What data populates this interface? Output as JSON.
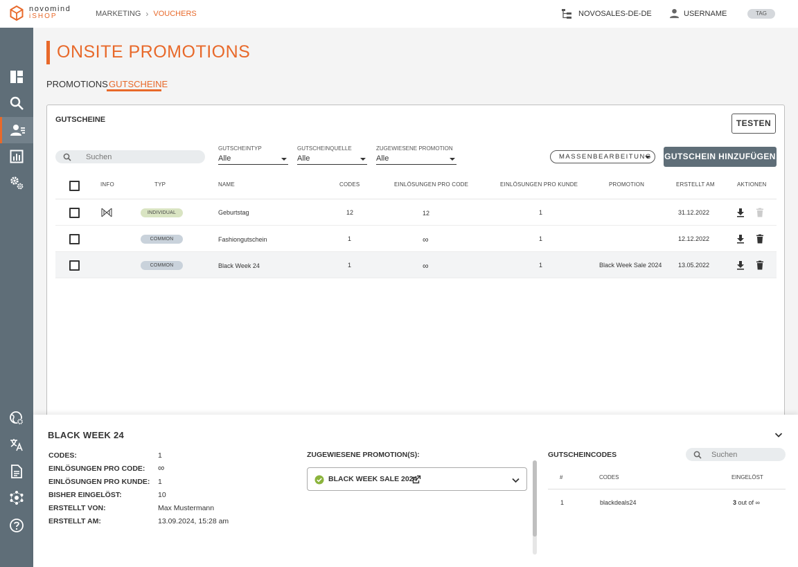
{
  "header": {
    "logo_line1": "novomind",
    "logo_line2": "iSHOP",
    "breadcrumb": [
      "MARKETING",
      "VOUCHERS"
    ],
    "shop": "NOVOSALES-DE-DE",
    "user": "USERNAME",
    "tag": "TAG"
  },
  "sidebar": {
    "items": [
      {
        "icon": "dashboard-icon"
      },
      {
        "icon": "search-icon"
      },
      {
        "icon": "customers-icon",
        "active": true
      },
      {
        "icon": "reports-icon"
      },
      {
        "icon": "settings-icon"
      },
      {
        "icon": "world-settings-icon"
      },
      {
        "icon": "translate-icon"
      },
      {
        "icon": "document-icon"
      },
      {
        "icon": "network-icon"
      },
      {
        "icon": "help-icon"
      }
    ]
  },
  "page": {
    "title": "ONSITE PROMOTIONS",
    "tabs": [
      {
        "label": "PROMOTIONS",
        "active": false
      },
      {
        "label": "GUTSCHEINE",
        "active": true
      }
    ]
  },
  "card": {
    "title": "GUTSCHEINE",
    "test_button": "TESTEN",
    "search_placeholder": "Suchen",
    "filters": [
      {
        "label": "GUTSCHEINTYP",
        "value": "Alle"
      },
      {
        "label": "GUTSCHEINQUELLE",
        "value": "Alle"
      },
      {
        "label": "ZUGEWIESENE PROMOTION",
        "value": "Alle"
      }
    ],
    "bulk_edit": "MASSENBEARBEITUNG",
    "add_button": "GUTSCHEIN HINZUFÜGEN"
  },
  "table": {
    "columns": [
      "INFO",
      "TYP",
      "NAME",
      "CODES",
      "EINLÖSUNGEN PRO CODE",
      "EINLÖSUNGEN PRO KUNDE",
      "PROMOTION",
      "ERSTELLT AM",
      "AKTIONEN"
    ],
    "rows": [
      {
        "info_icon": "import-icon",
        "type": "INDIVIDUAL",
        "name": "Geburtstag",
        "codes": "12",
        "per_code": "12",
        "per_customer": "1",
        "promotion": "",
        "created": "31.12.2022",
        "delete_disabled": true
      },
      {
        "info_icon": "",
        "type": "COMMON",
        "name": "Fashiongutschein",
        "codes": "1",
        "per_code": "∞",
        "per_customer": "1",
        "promotion": "",
        "created": "12.12.2022",
        "delete_disabled": false
      },
      {
        "info_icon": "",
        "type": "COMMON",
        "name": "Black Week 24",
        "codes": "1",
        "per_code": "∞",
        "per_customer": "1",
        "promotion": "Black Week Sale 2024",
        "created": "13.05.2022",
        "delete_disabled": false,
        "selected": true
      }
    ]
  },
  "detail": {
    "title": "BLACK WEEK 24",
    "fields": [
      {
        "label": "CODES:",
        "value": "1"
      },
      {
        "label": "EINLÖSUNGEN PRO CODE:",
        "value": "∞"
      },
      {
        "label": "EINLÖSUNGEN PRO KUNDE:",
        "value": "1"
      },
      {
        "label": "BISHER EINGELÖST:",
        "value": "10"
      },
      {
        "label": "ERSTELLT VON:",
        "value": "Max Mustermann"
      },
      {
        "label": "ERSTELLT AM:",
        "value": "13.09.2024, 15:28 am"
      }
    ],
    "assigned_label": "ZUGEWIESENE PROMOTION(S):",
    "assigned_promotion": "BLACK WEEK SALE 2024",
    "codes_label": "GUTSCHEINCODES",
    "codes_search_placeholder": "Suchen",
    "codes_columns": [
      "#",
      "CODES",
      "EINGELÖST"
    ],
    "codes_rows": [
      {
        "num": "1",
        "code": "blackdeals24",
        "redeemed_count": "3",
        "redeemed_rest": " out of ∞"
      }
    ]
  },
  "colors": {
    "accent": "#e8692a",
    "sidebar": "#5f6e78",
    "badge_individual": "#d9e4c2",
    "badge_common": "#c9d2db"
  }
}
